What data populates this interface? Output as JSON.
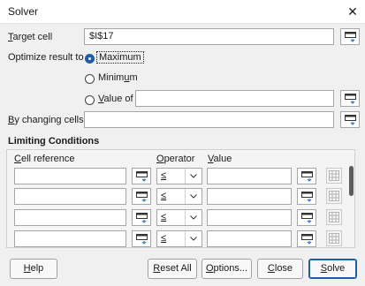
{
  "window": {
    "title": "Solver",
    "close_glyph": "✕"
  },
  "target_cell": {
    "label_first": "T",
    "label_rest": "arget cell",
    "value": "$I$17"
  },
  "optimize": {
    "label": "Optimize result to",
    "options": [
      {
        "label": "Maximum",
        "selected": true
      },
      {
        "label_pre": "Minim",
        "label_u": "u",
        "label_post": "m",
        "selected": false
      },
      {
        "label_pre": "",
        "label_u": "V",
        "label_post": "alue of",
        "selected": false,
        "value": ""
      }
    ]
  },
  "changing_cells": {
    "label_first": "B",
    "label_rest": "y changing cells",
    "value": ""
  },
  "limiting": {
    "heading": "Limiting Conditions",
    "col_cell_ref": {
      "u": "C",
      "rest": "ell reference"
    },
    "col_operator": {
      "u": "O",
      "rest": "perator"
    },
    "col_value": {
      "u": "V",
      "rest": "alue"
    },
    "rows": [
      {
        "cell": "",
        "operator": "≤",
        "value": ""
      },
      {
        "cell": "",
        "operator": "≤",
        "value": ""
      },
      {
        "cell": "",
        "operator": "≤",
        "value": ""
      },
      {
        "cell": "",
        "operator": "≤",
        "value": ""
      }
    ]
  },
  "buttons": {
    "help": {
      "u": "H",
      "rest": "elp"
    },
    "reset": {
      "u": "R",
      "rest": "eset All"
    },
    "options": {
      "u": "O",
      "rest": "ptions..."
    },
    "close": {
      "u": "C",
      "rest": "lose"
    },
    "solve": {
      "u": "S",
      "rest": "olve"
    }
  },
  "colors": {
    "accent": "#1e5ea8",
    "background": "#f0f0f0"
  },
  "icons": {
    "shrink": "shrink-selector-icon",
    "delete": "delete-row-icon",
    "dropdown": "chevron-down-icon"
  }
}
